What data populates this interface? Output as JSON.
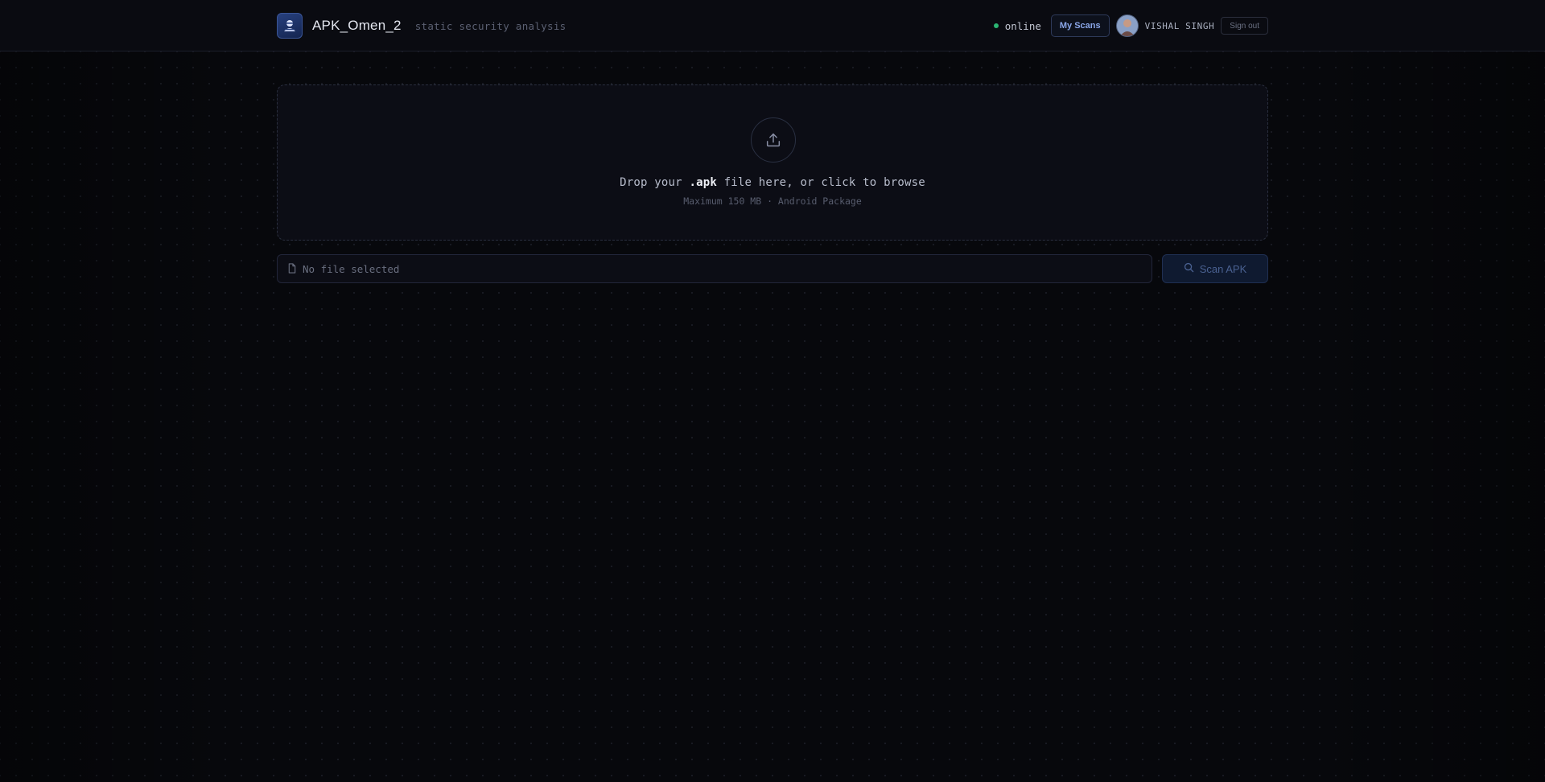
{
  "header": {
    "app_name": "APK_Omen_2",
    "tagline": "static security analysis",
    "status": {
      "label": "online",
      "color": "#2bb673"
    },
    "my_scans_label": "My Scans",
    "user_name": "VISHAL SINGH",
    "sign_out_label": "Sign out"
  },
  "upload": {
    "prompt_prefix": "Drop your",
    "prompt_ext": ".apk",
    "prompt_suffix": "file here, or click to browse",
    "subtext": "Maximum 150 MB · Android Package",
    "icon": "upload-icon"
  },
  "file_field": {
    "placeholder": "No file selected",
    "icon": "file-icon"
  },
  "scan_button": {
    "label": "Scan APK",
    "icon": "search-icon"
  },
  "colors": {
    "background": "#07080c",
    "accent": "#8aa6e8",
    "status_online": "#2bb673"
  }
}
